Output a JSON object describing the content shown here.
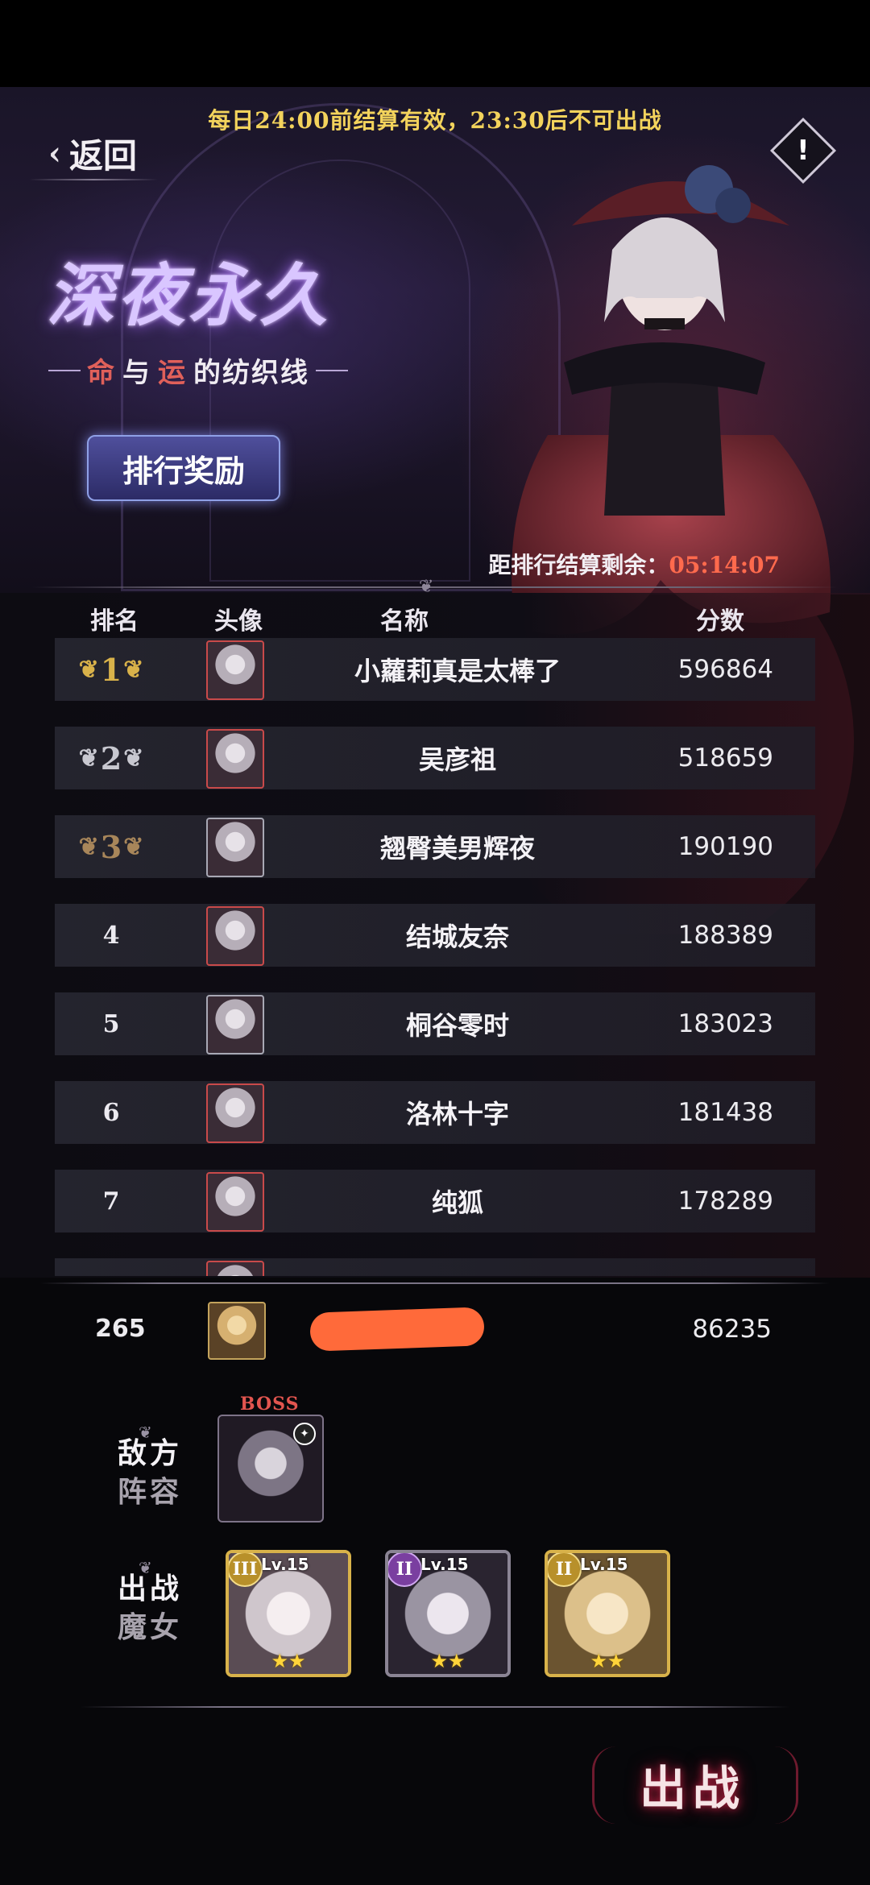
{
  "notice": "每日24:00前结算有效，23:30后不可出战",
  "nav": {
    "back_label": "返回",
    "info_glyph": "!"
  },
  "event": {
    "title": "深夜永久",
    "subtitle_parts": [
      "命",
      "与",
      "运",
      "的纺织线"
    ]
  },
  "reward_button": "排行奖励",
  "countdown": {
    "label": "距排行结算剩余：",
    "time": "05:14:07"
  },
  "table": {
    "headers": {
      "rank": "排名",
      "avatar": "头像",
      "name": "名称",
      "score": "分数"
    },
    "rows": [
      {
        "rank": "1",
        "name": "小蘿莉真是太棒了",
        "score": "596864"
      },
      {
        "rank": "2",
        "name": "吴彦祖",
        "score": "518659"
      },
      {
        "rank": "3",
        "name": "翘臀美男辉夜",
        "score": "190190"
      },
      {
        "rank": "4",
        "name": "结城友奈",
        "score": "188389"
      },
      {
        "rank": "5",
        "name": "桐谷零时",
        "score": "183023"
      },
      {
        "rank": "6",
        "name": "洛林十字",
        "score": "181438"
      },
      {
        "rank": "7",
        "name": "纯狐",
        "score": "178289"
      }
    ]
  },
  "me": {
    "rank": "265",
    "score": "86235"
  },
  "enemy": {
    "label_a": "敌方",
    "label_b": "阵容",
    "boss_tag": "BOSS"
  },
  "team": {
    "label_a": "出战",
    "label_b": "魔女",
    "cards": [
      {
        "tier": "III",
        "level": "Lv.15",
        "stars": "★★"
      },
      {
        "tier": "II",
        "level": "Lv.15",
        "stars": "★★"
      },
      {
        "tier": "II",
        "level": "Lv.15",
        "stars": "★★"
      }
    ]
  },
  "fight_button": "出战",
  "colors": {
    "notice": "#f3d35c",
    "countdown": "#ff6a4d",
    "accent_red": "#e2554f"
  }
}
